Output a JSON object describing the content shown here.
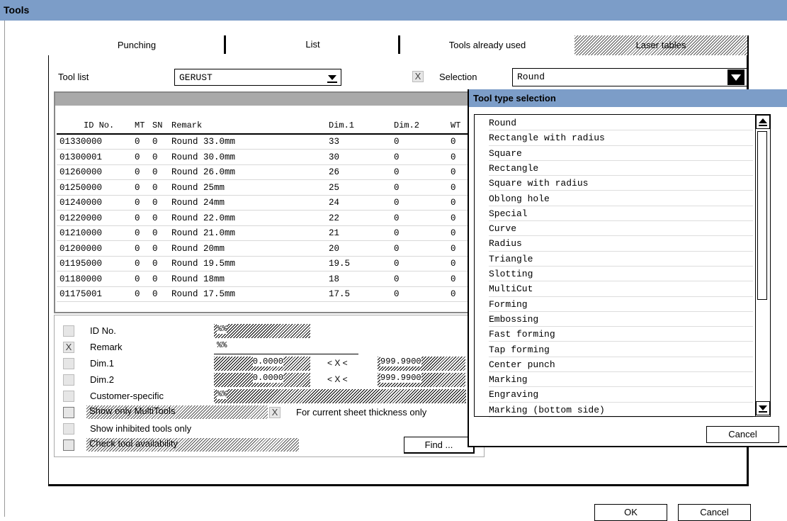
{
  "window": {
    "title": "Tools"
  },
  "tabs": [
    {
      "label": "Punching"
    },
    {
      "label": "List"
    },
    {
      "label": "Tools already used"
    },
    {
      "label": "Laser tables"
    }
  ],
  "toolbar": {
    "tool_list_label": "Tool list",
    "tool_list_value": "GERUST",
    "selection_checkbox": "X",
    "selection_label": "Selection",
    "selection_value": "Round"
  },
  "table": {
    "columns": [
      "ID No.",
      "MT",
      "SN",
      "Remark",
      "Dim.1",
      "Dim.2",
      "WT"
    ],
    "rows": [
      [
        "01330000",
        "0",
        "0",
        "Round 33.0mm",
        "33",
        "0",
        "0"
      ],
      [
        "01300001",
        "0",
        "0",
        "Round 30.0mm",
        "30",
        "0",
        "0"
      ],
      [
        "01260000",
        "0",
        "0",
        "Round 26.0mm",
        "26",
        "0",
        "0"
      ],
      [
        "01250000",
        "0",
        "0",
        "Round 25mm",
        "25",
        "0",
        "0"
      ],
      [
        "01240000",
        "0",
        "0",
        "Round 24mm",
        "24",
        "0",
        "0"
      ],
      [
        "01220000",
        "0",
        "0",
        "Round 22.0mm",
        "22",
        "0",
        "0"
      ],
      [
        "01210000",
        "0",
        "0",
        "Round 21.0mm",
        "21",
        "0",
        "0"
      ],
      [
        "01200000",
        "0",
        "0",
        "Round 20mm",
        "20",
        "0",
        "0"
      ],
      [
        "01195000",
        "0",
        "0",
        "Round 19.5mm",
        "19.5",
        "0",
        "0"
      ],
      [
        "01180000",
        "0",
        "0",
        "Round 18mm",
        "18",
        "0",
        "0"
      ],
      [
        "01175001",
        "0",
        "0",
        "Round 17.5mm",
        "17.5",
        "0",
        "0"
      ]
    ]
  },
  "filters": {
    "id_label": "ID No.",
    "id_value": "%%",
    "remark_label": "Remark",
    "remark_check": "X",
    "remark_value": "%%",
    "dim1_label": "Dim.1",
    "dim1_min": "0.0000",
    "dim1_op": "< X <",
    "dim1_max": "999.9900",
    "dim2_label": "Dim.2",
    "dim2_min": "0.0000",
    "dim2_op": "< X <",
    "dim2_max": "999.9900",
    "customer_label": "Customer-specific",
    "customer_value": "%%",
    "multitools_label": "Show only MultiTools",
    "sheet_check": "X",
    "sheet_label": "For current sheet thickness only",
    "inhibited_label": "Show inhibited tools only",
    "availability_label": "Check tool availability",
    "find_label": "Find ..."
  },
  "popup": {
    "title": "Tool type selection",
    "items": [
      "Round",
      "Rectangle with radius",
      "Square",
      "Rectangle",
      "Square with radius",
      "Oblong hole",
      "Special",
      "Curve",
      "Radius",
      "Triangle",
      "Slotting",
      "MultiCut",
      "Forming",
      "Embossing",
      "Fast forming",
      "Tap forming",
      "Center punch",
      "Marking",
      "Engraving",
      "Marking (bottom side)"
    ],
    "cancel_label": "Cancel"
  },
  "footer": {
    "ok_label": "OK",
    "cancel_label": "Cancel"
  }
}
